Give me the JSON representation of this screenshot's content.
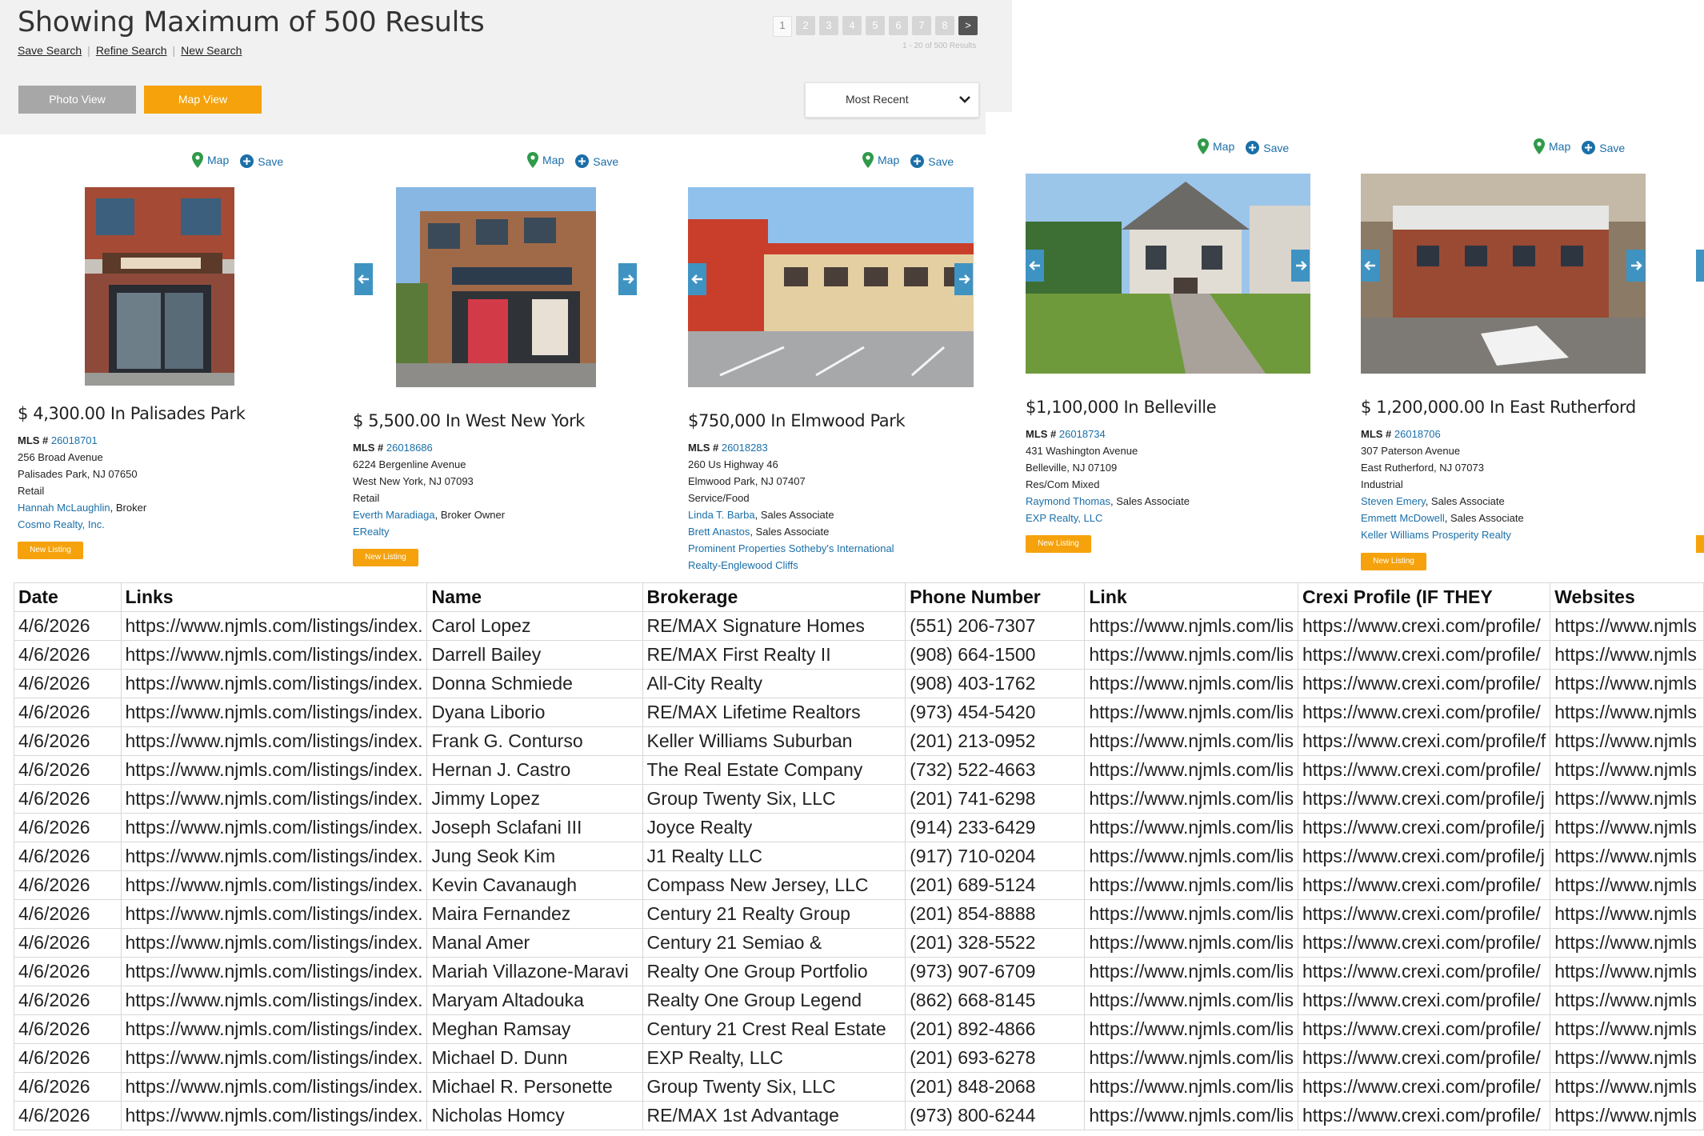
{
  "header": {
    "title": "Showing Maximum of 500 Results",
    "links": [
      "Save Search",
      "Refine Search",
      "New Search"
    ],
    "pages": [
      "1",
      "2",
      "3",
      "4",
      "5",
      "6",
      "7",
      "8"
    ],
    "next_page": ">",
    "results_count": "1 - 20 of 500 Results",
    "view_buttons": [
      "Photo View",
      "Map View"
    ],
    "sort_selected": "Most Recent"
  },
  "card_actions": {
    "map": "Map",
    "save": "Save"
  },
  "listings": [
    {
      "price": "$ 4,300.00 In Palisades Park",
      "mls_label": "MLS #",
      "mls": "26018701",
      "address": "256 Broad Avenue",
      "city": "Palisades Park, NJ 07650",
      "type": "Retail",
      "agents": [
        {
          "name": "Hannah McLaughlin",
          "role": ", Broker"
        }
      ],
      "brokerage": "Cosmo Realty, Inc.",
      "badge": "New Listing"
    },
    {
      "price": "$ 5,500.00 In West New York",
      "mls_label": "MLS #",
      "mls": "26018686",
      "address": "6224 Bergenline Avenue",
      "city": "West New York, NJ 07093",
      "type": "Retail",
      "agents": [
        {
          "name": "Everth Maradiaga",
          "role": ", Broker Owner"
        }
      ],
      "brokerage": "ERealty",
      "badge": "New Listing"
    },
    {
      "price": "$750,000 In Elmwood Park",
      "mls_label": "MLS #",
      "mls": "26018283",
      "address": "260 Us Highway 46",
      "city": "Elmwood Park, NJ 07407",
      "type": "Service/Food",
      "agents": [
        {
          "name": "Linda T. Barba",
          "role": ", Sales Associate"
        },
        {
          "name": "Brett Anastos",
          "role": ", Sales Associate"
        }
      ],
      "brokerage": "Prominent Properties Sotheby's International",
      "brokerage2": "Realty-Englewood Cliffs",
      "badge": ""
    },
    {
      "price": "$1,100,000 In Belleville",
      "mls_label": "MLS #",
      "mls": "26018734",
      "address": "431 Washington Avenue",
      "city": "Belleville, NJ 07109",
      "type": "Res/Com Mixed",
      "agents": [
        {
          "name": "Raymond Thomas",
          "role": ", Sales Associate"
        }
      ],
      "brokerage": "EXP Realty, LLC",
      "badge": "New Listing"
    },
    {
      "price": "$ 1,200,000.00 In East Rutherford",
      "mls_label": "MLS #",
      "mls": "26018706",
      "address": "307 Paterson Avenue",
      "city": "East Rutherford, NJ 07073",
      "type": "Industrial",
      "agents": [
        {
          "name": "Steven Emery",
          "role": ", Sales Associate"
        },
        {
          "name": "Emmett McDowell",
          "role": ", Sales Associate"
        }
      ],
      "brokerage": "Keller Williams Prosperity Realty",
      "badge": "New Listing"
    }
  ],
  "sheet": {
    "columns": [
      "Date",
      "Links",
      "Name",
      "Brokerage",
      "Phone Number",
      "Link",
      "Crexi Profile (IF THEY",
      "Websites"
    ],
    "rows": [
      [
        "4/6/2026",
        "https://www.njmls.com/listings/index.",
        "Carol Lopez",
        "RE/MAX Signature Homes",
        "(551) 206-7307",
        "https://www.njmls.com/lis",
        "https://www.crexi.com/profile/",
        "https://www.njmls"
      ],
      [
        "4/6/2026",
        "https://www.njmls.com/listings/index.",
        "Darrell Bailey",
        "RE/MAX First Realty II",
        "(908) 664-1500",
        "https://www.njmls.com/lis",
        "https://www.crexi.com/profile/",
        "https://www.njmls"
      ],
      [
        "4/6/2026",
        "https://www.njmls.com/listings/index.",
        "Donna Schmiede",
        "All-City Realty",
        "(908) 403-1762",
        "https://www.njmls.com/lis",
        "https://www.crexi.com/profile/",
        "https://www.njmls"
      ],
      [
        "4/6/2026",
        "https://www.njmls.com/listings/index.",
        "Dyana Liborio",
        "RE/MAX Lifetime Realtors",
        "(973) 454-5420",
        "https://www.njmls.com/lis",
        "https://www.crexi.com/profile/",
        "https://www.njmls"
      ],
      [
        "4/6/2026",
        "https://www.njmls.com/listings/index.",
        "Frank G. Conturso",
        "Keller Williams Suburban",
        "(201) 213-0952",
        "https://www.njmls.com/lis",
        "https://www.crexi.com/profile/f",
        "https://www.njmls"
      ],
      [
        "4/6/2026",
        "https://www.njmls.com/listings/index.",
        "Hernan J. Castro",
        "The Real Estate Company",
        "(732) 522-4663",
        "https://www.njmls.com/lis",
        "https://www.crexi.com/profile/",
        "https://www.njmls"
      ],
      [
        "4/6/2026",
        "https://www.njmls.com/listings/index.",
        "Jimmy Lopez",
        "Group Twenty Six, LLC",
        "(201) 741-6298",
        "https://www.njmls.com/lis",
        "https://www.crexi.com/profile/j",
        "https://www.njmls"
      ],
      [
        "4/6/2026",
        "https://www.njmls.com/listings/index.",
        "Joseph Sclafani III",
        "Joyce Realty",
        "(914) 233-6429",
        "https://www.njmls.com/lis",
        "https://www.crexi.com/profile/j",
        "https://www.njmls"
      ],
      [
        "4/6/2026",
        "https://www.njmls.com/listings/index.",
        "Jung Seok Kim",
        "J1 Realty LLC",
        "(917) 710-0204",
        "https://www.njmls.com/lis",
        "https://www.crexi.com/profile/j",
        "https://www.njmls"
      ],
      [
        "4/6/2026",
        "https://www.njmls.com/listings/index.",
        "Kevin Cavanaugh",
        "Compass New Jersey, LLC",
        "(201) 689-5124",
        "https://www.njmls.com/lis",
        "https://www.crexi.com/profile/",
        "https://www.njmls"
      ],
      [
        "4/6/2026",
        "https://www.njmls.com/listings/index.",
        "Maira Fernandez",
        "Century 21 Realty Group",
        "(201) 854-8888",
        "https://www.njmls.com/lis",
        "https://www.crexi.com/profile/",
        "https://www.njmls"
      ],
      [
        "4/6/2026",
        "https://www.njmls.com/listings/index.",
        "Manal Amer",
        "Century 21 Semiao &",
        "(201) 328-5522",
        "https://www.njmls.com/lis",
        "https://www.crexi.com/profile/",
        "https://www.njmls"
      ],
      [
        "4/6/2026",
        "https://www.njmls.com/listings/index.",
        "Mariah Villazone-Maravi",
        "Realty One Group Portfolio",
        "(973) 907-6709",
        "https://www.njmls.com/lis",
        "https://www.crexi.com/profile/",
        "https://www.njmls"
      ],
      [
        "4/6/2026",
        "https://www.njmls.com/listings/index.",
        "Maryam Altadouka",
        "Realty One Group Legend",
        "(862) 668-8145",
        "https://www.njmls.com/lis",
        "https://www.crexi.com/profile/",
        "https://www.njmls"
      ],
      [
        "4/6/2026",
        "https://www.njmls.com/listings/index.",
        "Meghan Ramsay",
        "Century 21 Crest Real Estate",
        "(201) 892-4866",
        "https://www.njmls.com/lis",
        "https://www.crexi.com/profile/",
        "https://www.njmls"
      ],
      [
        "4/6/2026",
        "https://www.njmls.com/listings/index.",
        "Michael D. Dunn",
        "EXP Realty, LLC",
        "(201) 693-6278",
        "https://www.njmls.com/lis",
        "https://www.crexi.com/profile/",
        "https://www.njmls"
      ],
      [
        "4/6/2026",
        "https://www.njmls.com/listings/index.",
        "Michael R. Personette",
        "Group Twenty Six, LLC",
        "(201) 848-2068",
        "https://www.njmls.com/lis",
        "https://www.crexi.com/profile/",
        "https://www.njmls"
      ],
      [
        "4/6/2026",
        "https://www.njmls.com/listings/index.",
        "Nicholas Homcy",
        "RE/MAX 1st Advantage",
        "(973) 800-6244",
        "https://www.njmls.com/lis",
        "https://www.crexi.com/profile/",
        "https://www.njmls"
      ]
    ]
  },
  "colors": {
    "accent_orange": "#f5a20c",
    "link_blue": "#1b6fa8",
    "arrow_blue": "#3f93c3",
    "header_gray": "#f1f1f1"
  }
}
